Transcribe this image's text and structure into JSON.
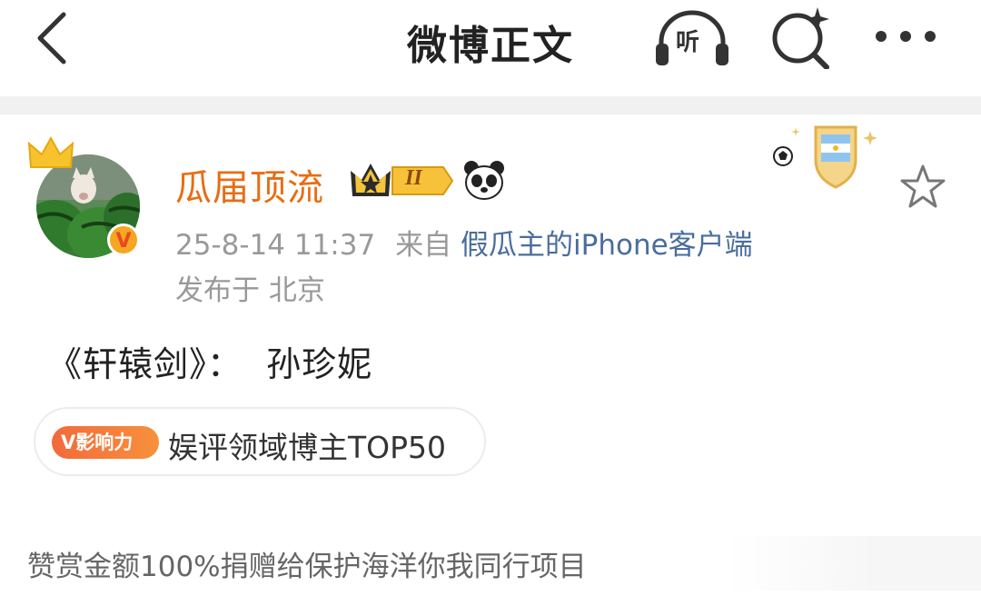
{
  "header": {
    "title": "微博正文",
    "listen_label": "听"
  },
  "post": {
    "username": "瓜届顶流",
    "vip_level": "II",
    "time": "25-8-14 11:37",
    "from_prefix": "来自",
    "client": "假瓜主的iPhone客户端",
    "location": "发布于 北京",
    "content": "《轩辕剑》：  孙珍妮",
    "tag": {
      "badge": "V影响力",
      "text": "娱评领域博主TOP50"
    },
    "reward_text": "赞赏金额100%捐赠给保护海洋你我同行项目"
  },
  "colors": {
    "username": "#e86c13",
    "client_link": "#4a6d9c",
    "meta": "#999999",
    "tag_badge": "#f26a3b"
  }
}
